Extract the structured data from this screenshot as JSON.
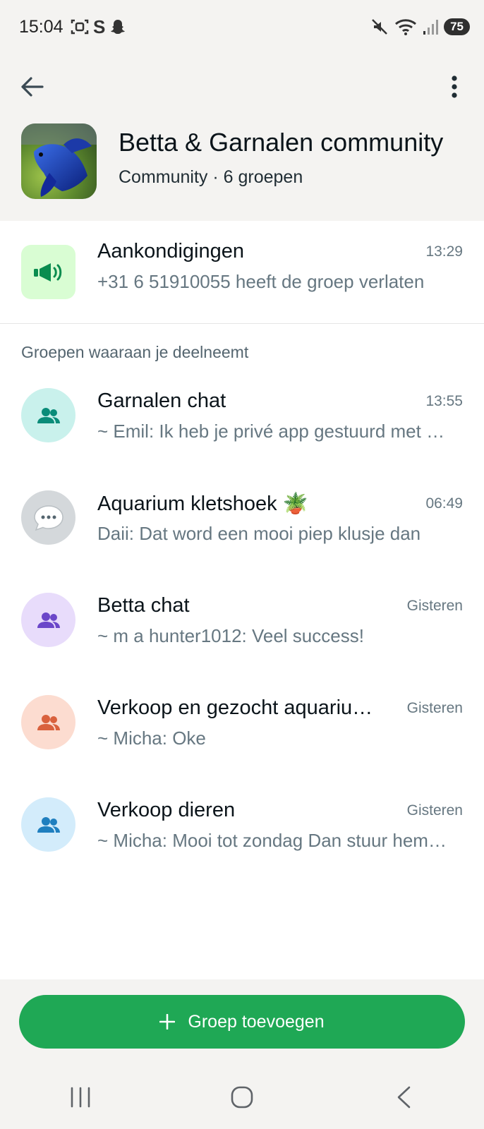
{
  "status_bar": {
    "time": "15:04",
    "battery": "75"
  },
  "header": {
    "title": "Betta & Garnalen community",
    "subtitle": "Community · 6 groepen"
  },
  "announcements": {
    "title": "Aankondigingen",
    "time": "13:29",
    "preview": "+31 6 51910055 heeft de groep verlaten"
  },
  "section_label": "Groepen waaraan je deelneemt",
  "groups": [
    {
      "title": "Garnalen chat",
      "time": "13:55",
      "preview": "~ Emil: Ik heb je privé app gestuurd met de prijzen",
      "avatar_bg": "#c9f1ec",
      "icon_color": "#0a8c79",
      "icon": "people-icon"
    },
    {
      "title": "Aquarium kletshoek 🪴",
      "time": "06:49",
      "preview": "Daii: Dat word een mooi piep klusje dan",
      "avatar_bg": "#d4d8db",
      "icon_color": "#ffffff",
      "icon": "speech-bubble-icon"
    },
    {
      "title": "Betta chat",
      "time": "Gisteren",
      "preview": "~ m a hunter1012: Veel success!",
      "avatar_bg": "#e8dcfb",
      "icon_color": "#6b47c9",
      "icon": "people-icon"
    },
    {
      "title": "Verkoop en gezocht aquarium spullen",
      "time": "Gisteren",
      "preview": "~ Micha: Oke",
      "avatar_bg": "#fcdcd0",
      "icon_color": "#d9613d",
      "icon": "people-icon"
    },
    {
      "title": "Verkoop dieren",
      "time": "Gisteren",
      "preview": "~ Micha: Mooi tot zondag Dan stuur hem door",
      "avatar_bg": "#d3ecfb",
      "icon_color": "#1f7fbf",
      "icon": "people-icon"
    }
  ],
  "footer": {
    "add_button_label": "Groep toevoegen"
  },
  "colors": {
    "accent": "#1fa855",
    "announce_bg": "#d9fdd3",
    "announce_icon": "#0a8c4f"
  }
}
